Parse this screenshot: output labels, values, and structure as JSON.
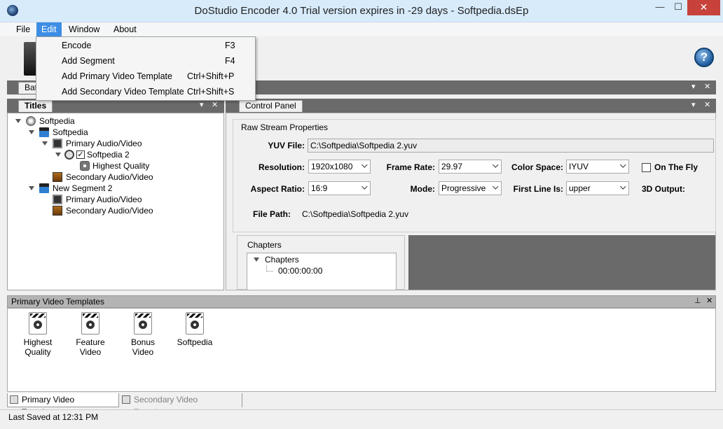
{
  "window": {
    "title": "DoStudio Encoder 4.0  Trial version expires in -29 days  - Softpedia.dsEp",
    "minimize": "—",
    "maximize": "☐",
    "close": "✕"
  },
  "menubar": {
    "items": [
      "File",
      "Edit",
      "Window",
      "About"
    ],
    "active": "Edit"
  },
  "edit_menu": [
    {
      "label": "Encode",
      "shortcut": "F3"
    },
    {
      "label": "Add Segment",
      "shortcut": "F4"
    },
    {
      "label": "Add Primary Video Template",
      "shortcut": "Ctrl+Shift+P"
    },
    {
      "label": "Add Secondary Video Template",
      "shortcut": "Ctrl+Shift+S"
    }
  ],
  "toolbar": {
    "help": "?"
  },
  "top_strip": {
    "tab_partial": "Bat",
    "dropdown": "▾",
    "close": "✕"
  },
  "titles_panel": {
    "tab": "Titles",
    "dropdown": "▾",
    "close": "✕",
    "tree": [
      {
        "label": "Softpedia",
        "level": 0,
        "icon": "disc-icon"
      },
      {
        "label": "Softpedia",
        "level": 1,
        "icon": "clapper-icon"
      },
      {
        "label": "Primary Audio/Video",
        "level": 2,
        "icon": "monitor-icon"
      },
      {
        "label": "Softpedia 2",
        "level": 3,
        "icon": "reel-icon",
        "checked": true
      },
      {
        "label": "Highest Quality",
        "level": 4,
        "icon": "gear-icon"
      },
      {
        "label": "Secondary Audio/Video",
        "level": 2,
        "icon": "av-icon"
      },
      {
        "label": "New Segment 2",
        "level": 1,
        "icon": "clapper-icon"
      },
      {
        "label": "Primary Audio/Video",
        "level": 2,
        "icon": "monitor-icon"
      },
      {
        "label": "Secondary Audio/Video",
        "level": 2,
        "icon": "av-icon"
      }
    ]
  },
  "control_panel": {
    "tab": "Control Panel",
    "dropdown": "▾",
    "close": "✕",
    "group_title": "Raw Stream Properties",
    "yuv_label": "YUV File:",
    "yuv_value": "C:\\Softpedia\\Softpedia 2.yuv",
    "resolution_label": "Resolution:",
    "resolution_value": "1920x1080",
    "frame_rate_label": "Frame Rate:",
    "frame_rate_value": "29.97",
    "color_space_label": "Color Space:",
    "color_space_value": "IYUV",
    "on_the_fly_label": "On The Fly",
    "aspect_label": "Aspect Ratio:",
    "aspect_value": "16:9",
    "mode_label": "Mode:",
    "mode_value": "Progressive",
    "first_line_label": "First Line Is:",
    "first_line_value": "upper",
    "output_3d_label": "3D Output:",
    "file_path_label": "File Path:",
    "file_path_value": "C:\\Softpedia\\Softpedia 2.yuv",
    "chapters_group": "Chapters",
    "chapters_root": "Chapters",
    "chapter_time": "00:00:00:00"
  },
  "templates": {
    "header": "Primary Video Templates",
    "pin": "⊥",
    "close": "✕",
    "items": [
      "Highest Quality",
      "Feature Video",
      "Bonus Video",
      "Softpedia"
    ],
    "tabs": [
      "Primary Video Templates",
      "Secondary Video Templates"
    ]
  },
  "status": "Last Saved at 12:31 PM",
  "colors": {
    "accent": "#3d8ee4",
    "close_red": "#c7423a",
    "titlebar": "#d7ebfb",
    "strip": "#6a6a6a"
  }
}
